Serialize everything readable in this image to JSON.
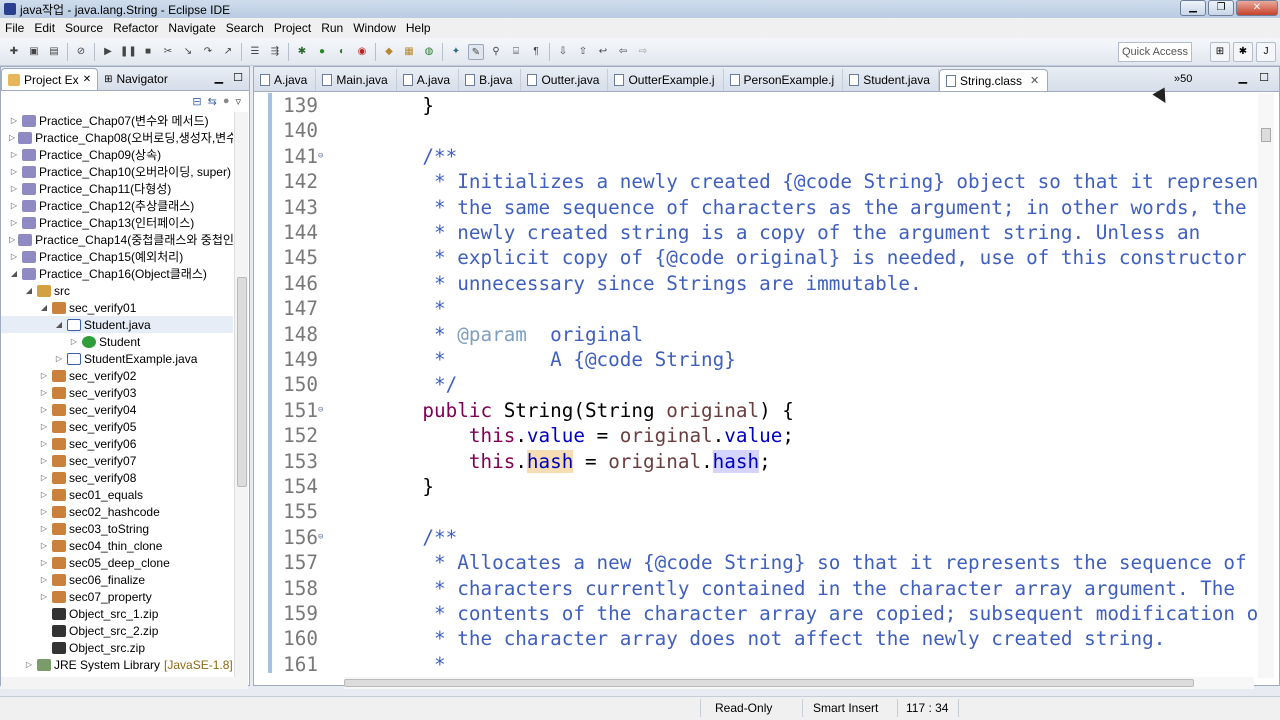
{
  "window": {
    "title": "java작업 - java.lang.String - Eclipse IDE"
  },
  "menu": [
    "File",
    "Edit",
    "Source",
    "Refactor",
    "Navigate",
    "Search",
    "Project",
    "Run",
    "Window",
    "Help"
  ],
  "quick_access": "Quick Access",
  "left_panel": {
    "tabs": [
      {
        "label": "Project Ex"
      },
      {
        "label": "Navigator"
      }
    ],
    "tree": [
      {
        "depth": 0,
        "icon": "project",
        "label": "Practice_Chap07(변수와 메서드)",
        "open": false
      },
      {
        "depth": 0,
        "icon": "project",
        "label": "Practice_Chap08(오버로딩,생성자,변수",
        "open": false
      },
      {
        "depth": 0,
        "icon": "project",
        "label": "Practice_Chap09(상속)",
        "open": false
      },
      {
        "depth": 0,
        "icon": "project",
        "label": "Practice_Chap10(오버라이딩, super)",
        "open": false
      },
      {
        "depth": 0,
        "icon": "project",
        "label": "Practice_Chap11(다형성)",
        "open": false
      },
      {
        "depth": 0,
        "icon": "project",
        "label": "Practice_Chap12(추상클래스)",
        "open": false
      },
      {
        "depth": 0,
        "icon": "project",
        "label": "Practice_Chap13(인터페이스)",
        "open": false
      },
      {
        "depth": 0,
        "icon": "project",
        "label": "Practice_Chap14(중첩클래스와 중첩인",
        "open": false
      },
      {
        "depth": 0,
        "icon": "project",
        "label": "Practice_Chap15(예외처리)",
        "open": false
      },
      {
        "depth": 0,
        "icon": "project",
        "label": "Practice_Chap16(Object클래스)",
        "open": true
      },
      {
        "depth": 1,
        "icon": "src",
        "label": "src",
        "open": true
      },
      {
        "depth": 2,
        "icon": "pkg",
        "label": "sec_verify01",
        "open": true
      },
      {
        "depth": 3,
        "icon": "java",
        "label": "Student.java",
        "open": true,
        "selected": true
      },
      {
        "depth": 4,
        "icon": "class",
        "label": "Student",
        "open": false
      },
      {
        "depth": 3,
        "icon": "java",
        "label": "StudentExample.java",
        "open": false
      },
      {
        "depth": 2,
        "icon": "pkg",
        "label": "sec_verify02",
        "open": false
      },
      {
        "depth": 2,
        "icon": "pkg",
        "label": "sec_verify03",
        "open": false
      },
      {
        "depth": 2,
        "icon": "pkg",
        "label": "sec_verify04",
        "open": false
      },
      {
        "depth": 2,
        "icon": "pkg",
        "label": "sec_verify05",
        "open": false
      },
      {
        "depth": 2,
        "icon": "pkg",
        "label": "sec_verify06",
        "open": false
      },
      {
        "depth": 2,
        "icon": "pkg",
        "label": "sec_verify07",
        "open": false
      },
      {
        "depth": 2,
        "icon": "pkg",
        "label": "sec_verify08",
        "open": false
      },
      {
        "depth": 2,
        "icon": "pkg",
        "label": "sec01_equals",
        "open": false
      },
      {
        "depth": 2,
        "icon": "pkg",
        "label": "sec02_hashcode",
        "open": false
      },
      {
        "depth": 2,
        "icon": "pkg",
        "label": "sec03_toString",
        "open": false
      },
      {
        "depth": 2,
        "icon": "pkg",
        "label": "sec04_thin_clone",
        "open": false
      },
      {
        "depth": 2,
        "icon": "pkg",
        "label": "sec05_deep_clone",
        "open": false
      },
      {
        "depth": 2,
        "icon": "pkg",
        "label": "sec06_finalize",
        "open": false
      },
      {
        "depth": 2,
        "icon": "pkg",
        "label": "sec07_property",
        "open": false
      },
      {
        "depth": 2,
        "icon": "zip",
        "label": "Object_src_1.zip",
        "open": null
      },
      {
        "depth": 2,
        "icon": "zip",
        "label": "Object_src_2.zip",
        "open": null
      },
      {
        "depth": 2,
        "icon": "zip",
        "label": "Object_src.zip",
        "open": null
      },
      {
        "depth": 1,
        "icon": "lib",
        "label": "JRE System Library",
        "tag": "[JavaSE-1.8]",
        "open": false
      }
    ]
  },
  "editor": {
    "tabs": [
      {
        "label": "A.java",
        "active": false
      },
      {
        "label": "Main.java",
        "active": false
      },
      {
        "label": "A.java",
        "active": false
      },
      {
        "label": "B.java",
        "active": false
      },
      {
        "label": "Outter.java",
        "active": false
      },
      {
        "label": "OutterExample.j",
        "active": false
      },
      {
        "label": "PersonExample.j",
        "active": false
      },
      {
        "label": "Student.java",
        "active": false
      },
      {
        "label": "String.class",
        "active": true
      }
    ],
    "overflow_count": "»50",
    "lines": [
      {
        "n": "139",
        "fold": false,
        "segs": [
          [
            "p",
            "    }"
          ]
        ]
      },
      {
        "n": "140",
        "fold": false,
        "segs": []
      },
      {
        "n": "141",
        "fold": true,
        "segs": [
          [
            "jd",
            "    /**"
          ]
        ]
      },
      {
        "n": "142",
        "fold": false,
        "segs": [
          [
            "jd",
            "     * Initializes a newly created {@code String} object so that it represen"
          ]
        ]
      },
      {
        "n": "143",
        "fold": false,
        "segs": [
          [
            "jd",
            "     * the same sequence of characters as the argument; in other words, the"
          ]
        ]
      },
      {
        "n": "144",
        "fold": false,
        "segs": [
          [
            "jd",
            "     * newly created string is a copy of the argument string. Unless an"
          ]
        ]
      },
      {
        "n": "145",
        "fold": false,
        "segs": [
          [
            "jd",
            "     * explicit copy of {@code original} is needed, use of this constructor"
          ]
        ]
      },
      {
        "n": "146",
        "fold": false,
        "segs": [
          [
            "jd",
            "     * unnecessary since Strings are immutable."
          ]
        ]
      },
      {
        "n": "147",
        "fold": false,
        "segs": [
          [
            "jd",
            "     *"
          ]
        ]
      },
      {
        "n": "148",
        "fold": false,
        "segs": [
          [
            "jd",
            "     * "
          ],
          [
            "jdt",
            "@param"
          ],
          [
            "jd",
            "  original"
          ]
        ]
      },
      {
        "n": "149",
        "fold": false,
        "segs": [
          [
            "jd",
            "     *         A {@code String}"
          ]
        ]
      },
      {
        "n": "150",
        "fold": false,
        "segs": [
          [
            "jd",
            "     */"
          ]
        ]
      },
      {
        "n": "151",
        "fold": true,
        "segs": [
          [
            "kw",
            "    public"
          ],
          [
            "p",
            " String(String "
          ],
          [
            "prm",
            "original"
          ],
          [
            "p",
            ") {"
          ]
        ]
      },
      {
        "n": "152",
        "fold": false,
        "segs": [
          [
            "kw",
            "        this"
          ],
          [
            "p",
            "."
          ],
          [
            "fld",
            "value"
          ],
          [
            "p",
            " = "
          ],
          [
            "prm",
            "original"
          ],
          [
            "p",
            "."
          ],
          [
            "fld",
            "value"
          ],
          [
            "p",
            ";"
          ]
        ]
      },
      {
        "n": "153",
        "fold": false,
        "segs": [
          [
            "kw",
            "        this"
          ],
          [
            "p",
            "."
          ],
          [
            "fldhl2",
            "hash"
          ],
          [
            "p",
            " = "
          ],
          [
            "prm",
            "original"
          ],
          [
            "p",
            "."
          ],
          [
            "fldhl",
            "hash"
          ],
          [
            "p",
            ";"
          ]
        ]
      },
      {
        "n": "154",
        "fold": false,
        "segs": [
          [
            "p",
            "    }"
          ]
        ]
      },
      {
        "n": "155",
        "fold": false,
        "segs": []
      },
      {
        "n": "156",
        "fold": true,
        "segs": [
          [
            "jd",
            "    /**"
          ]
        ]
      },
      {
        "n": "157",
        "fold": false,
        "segs": [
          [
            "jd",
            "     * Allocates a new {@code String} so that it represents the sequence of"
          ]
        ]
      },
      {
        "n": "158",
        "fold": false,
        "segs": [
          [
            "jd",
            "     * characters currently contained in the character array argument. The"
          ]
        ]
      },
      {
        "n": "159",
        "fold": false,
        "segs": [
          [
            "jd",
            "     * contents of the character array are copied; subsequent modification o"
          ]
        ]
      },
      {
        "n": "160",
        "fold": false,
        "segs": [
          [
            "jd",
            "     * the character array does not affect the newly created string."
          ]
        ]
      },
      {
        "n": "161",
        "fold": false,
        "segs": [
          [
            "jd",
            "     *"
          ]
        ]
      }
    ]
  },
  "status": {
    "mode": "Read-Only",
    "insert": "Smart Insert",
    "position": "117 : 34"
  }
}
